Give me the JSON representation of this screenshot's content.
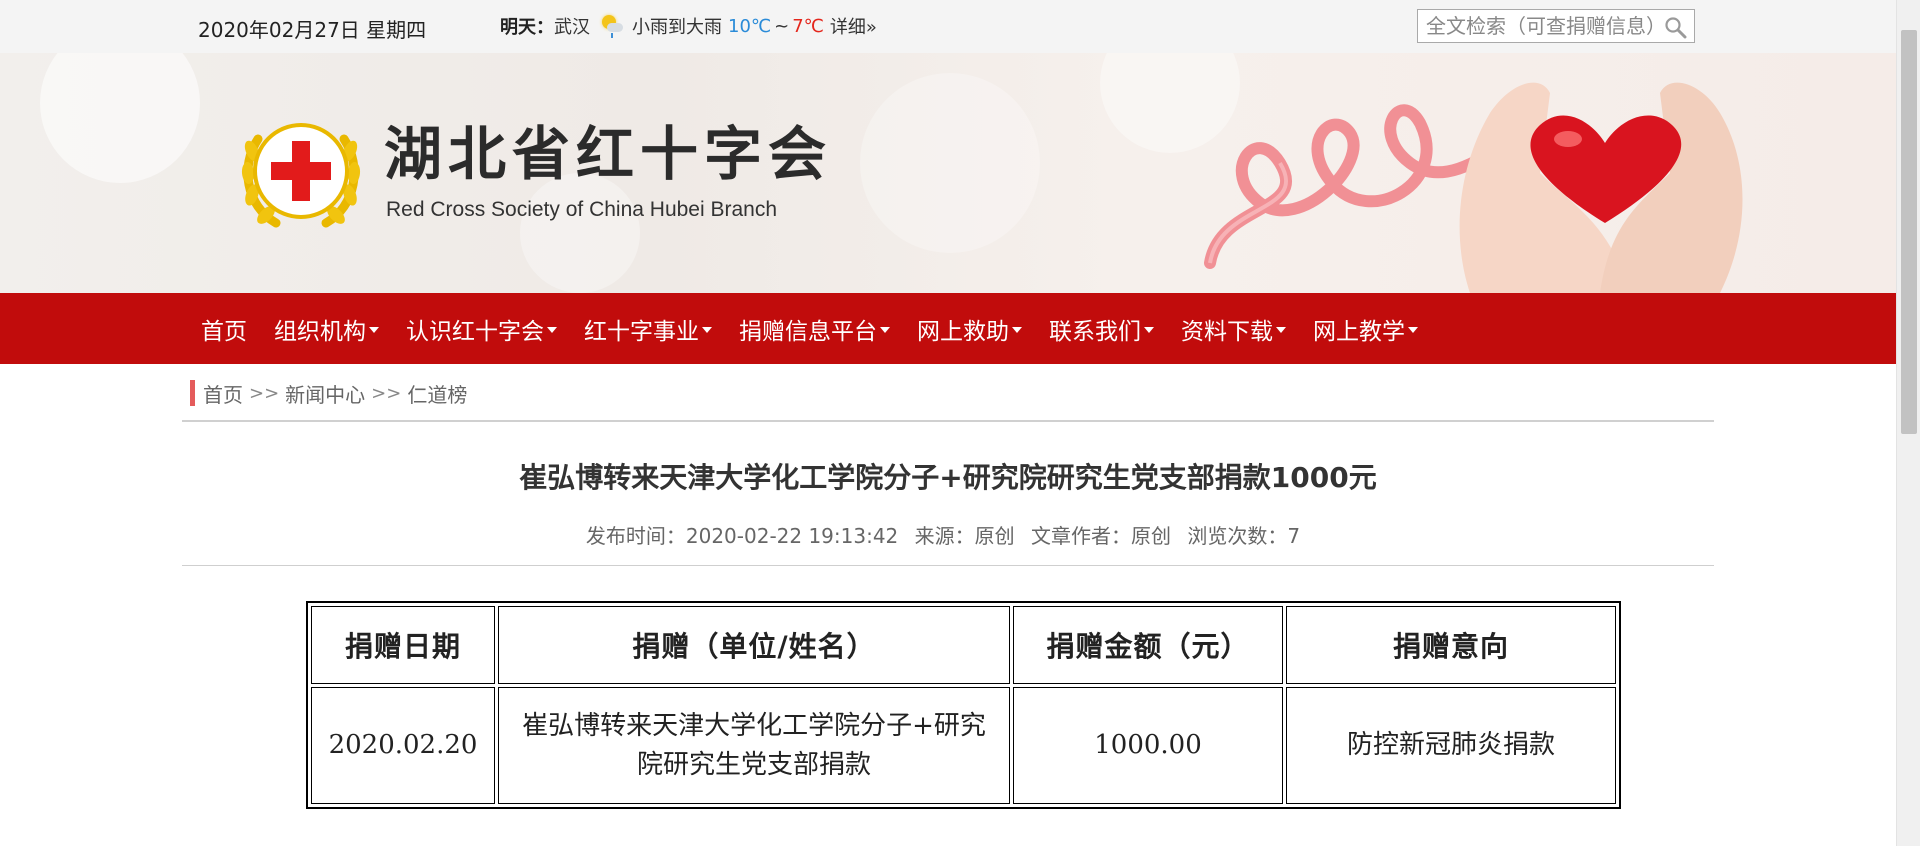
{
  "topbar": {
    "date": "2020年02月27日 星期四",
    "weather": {
      "label": "明天：",
      "city": "武汉",
      "icon": "rain-sun-icon",
      "condition": "小雨到大雨",
      "temp_low": "10℃",
      "tilde": "~",
      "temp_high": "7℃",
      "detail": "详细»",
      "low_color": "#2a8bd8",
      "high_color": "#e4261c"
    },
    "search": {
      "placeholder": "全文检索（可查捐赠信息）"
    }
  },
  "banner": {
    "title_cn": "湖北省红十字会",
    "title_en": "Red Cross Society of China Hubei Branch"
  },
  "nav": {
    "items": [
      {
        "label": "首页",
        "dropdown": false
      },
      {
        "label": "组织机构",
        "dropdown": true
      },
      {
        "label": "认识红十字会",
        "dropdown": true
      },
      {
        "label": "红十字事业",
        "dropdown": true
      },
      {
        "label": "捐赠信息平台",
        "dropdown": true
      },
      {
        "label": "网上救助",
        "dropdown": true
      },
      {
        "label": "联系我们",
        "dropdown": true
      },
      {
        "label": "资料下载",
        "dropdown": true
      },
      {
        "label": "网上教学",
        "dropdown": true
      }
    ],
    "color": "#c10c0c"
  },
  "breadcrumb": {
    "items": [
      "首页",
      "新闻中心",
      "仁道榜"
    ],
    "separator": ">>"
  },
  "article": {
    "title": "崔弘博转来天津大学化工学院分子+研究院研究生党支部捐款1000元",
    "meta": {
      "publish_time": "发布时间：2020-02-22 19:13:42",
      "source": "来源：原创",
      "author": "文章作者：原创",
      "views": "浏览次数：7"
    }
  },
  "table": {
    "headers": [
      "捐赠日期",
      "捐赠（单位/姓名）",
      "捐赠金额（元）",
      "捐赠意向"
    ],
    "rows": [
      [
        "2020.02.20",
        "崔弘博转来天津大学化工学院分子+研究院研究生党支部捐款",
        "1000.00",
        "防控新冠肺炎捐款"
      ]
    ]
  }
}
